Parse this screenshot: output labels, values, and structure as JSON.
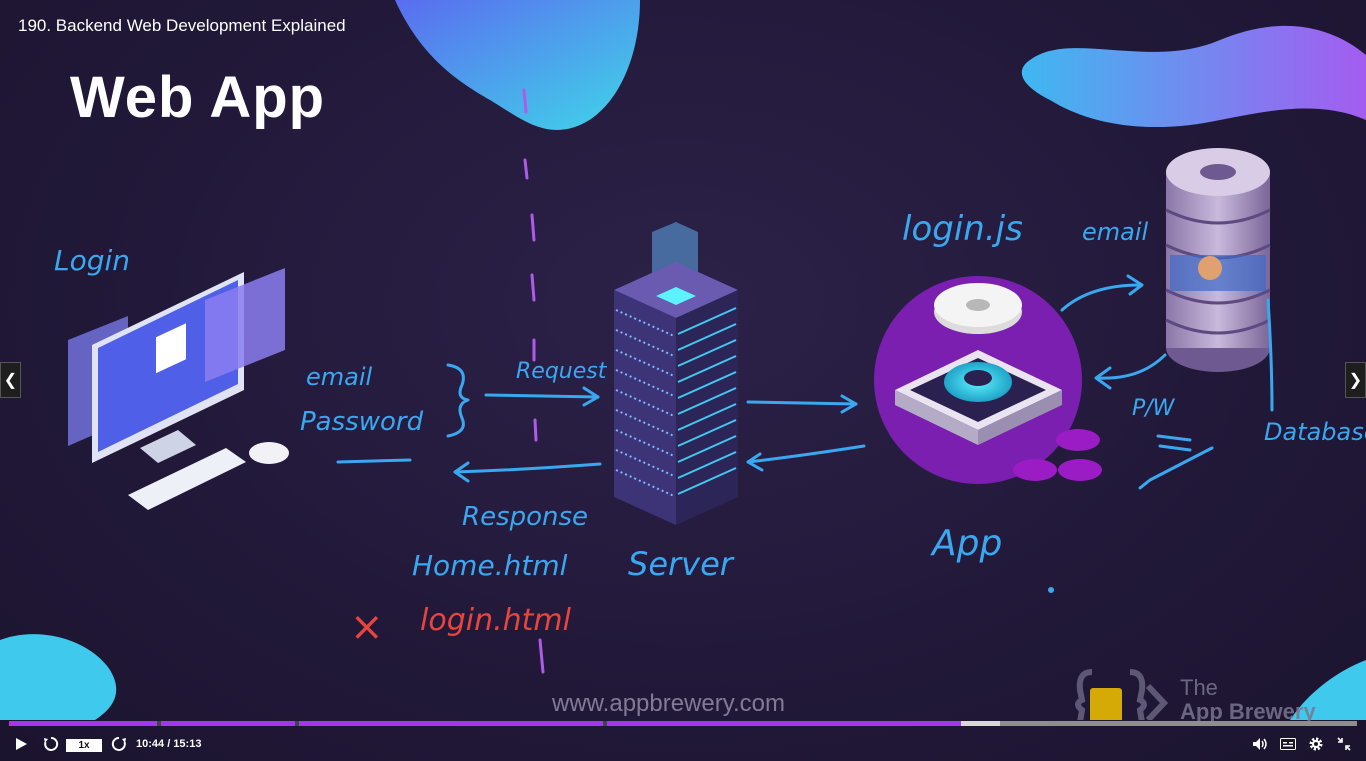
{
  "player": {
    "title": "190. Backend Web Development Explained",
    "speed": "1x",
    "time": "10:44 / 15:13",
    "progress_played": 0.706,
    "progress_buffered": 0.735
  },
  "slide": {
    "heading": "Web App",
    "notes": {
      "login": "Login",
      "email": "email",
      "password": "Password",
      "request": "Request",
      "response": "Response",
      "home_html": "Home.html",
      "login_html": "login.html",
      "x_mark": "×",
      "server": "Server",
      "app": "App",
      "login_js": "login.js",
      "email2": "email",
      "pw": "P/W",
      "database": "Database"
    },
    "watermark": "www.appbrewery.com",
    "brand_line1": "The",
    "brand_line2": "App Brewery"
  },
  "colors": {
    "accent": "#a435f0",
    "ink_blue": "#3aa8f0",
    "ink_red": "#e8453c"
  },
  "icons": {
    "prev": "chevron-left-icon",
    "next": "chevron-right-icon",
    "play": "play-icon",
    "rewind": "rewind-5-icon",
    "forward": "forward-5-icon",
    "volume": "volume-icon",
    "captions": "captions-icon",
    "settings": "gear-icon",
    "fullscreen": "exit-fullscreen-icon"
  }
}
